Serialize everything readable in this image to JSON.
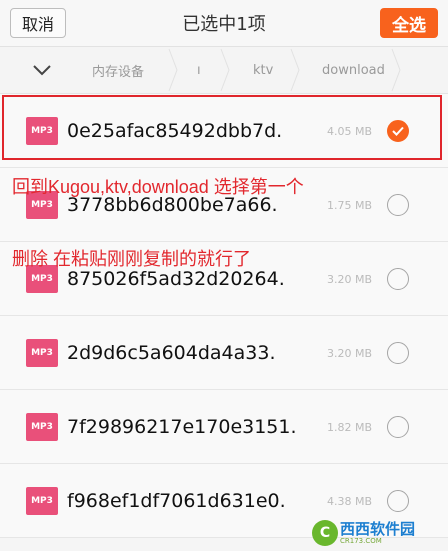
{
  "header": {
    "cancel_label": "取消",
    "title": "已选中1项",
    "select_all_label": "全选"
  },
  "breadcrumb": {
    "items": [
      "内存设备",
      "ı",
      "ktv",
      "download"
    ]
  },
  "files": [
    {
      "name": "0e25afac85492dbb7d.",
      "size": "4.05 MB",
      "selected": true,
      "badge": "MP3"
    },
    {
      "name": "3778bb6d800be7a66.",
      "size": "1.75 MB",
      "selected": false,
      "badge": "MP3"
    },
    {
      "name": "875026f5ad32d20264.",
      "size": "3.20 MB",
      "selected": false,
      "badge": "MP3"
    },
    {
      "name": "2d9d6c5a604da4a33.",
      "size": "3.20 MB",
      "selected": false,
      "badge": "MP3"
    },
    {
      "name": "7f29896217e170e3151.",
      "size": "1.82 MB",
      "selected": false,
      "badge": "MP3"
    },
    {
      "name": "f968ef1df7061d631e0.",
      "size": "4.38 MB",
      "selected": false,
      "badge": "MP3"
    }
  ],
  "annotations": {
    "line1": "回到Kugou,ktv,download  选择第一个",
    "line2": "删除   在粘贴刚刚复制的就行了"
  },
  "watermark": {
    "logo_char": "C",
    "name": "西西软件园",
    "site": "CR173.COM"
  },
  "colors": {
    "accent": "#f8621d",
    "mp3_badge": "#e9507a",
    "annotation_red": "#e2282e"
  }
}
